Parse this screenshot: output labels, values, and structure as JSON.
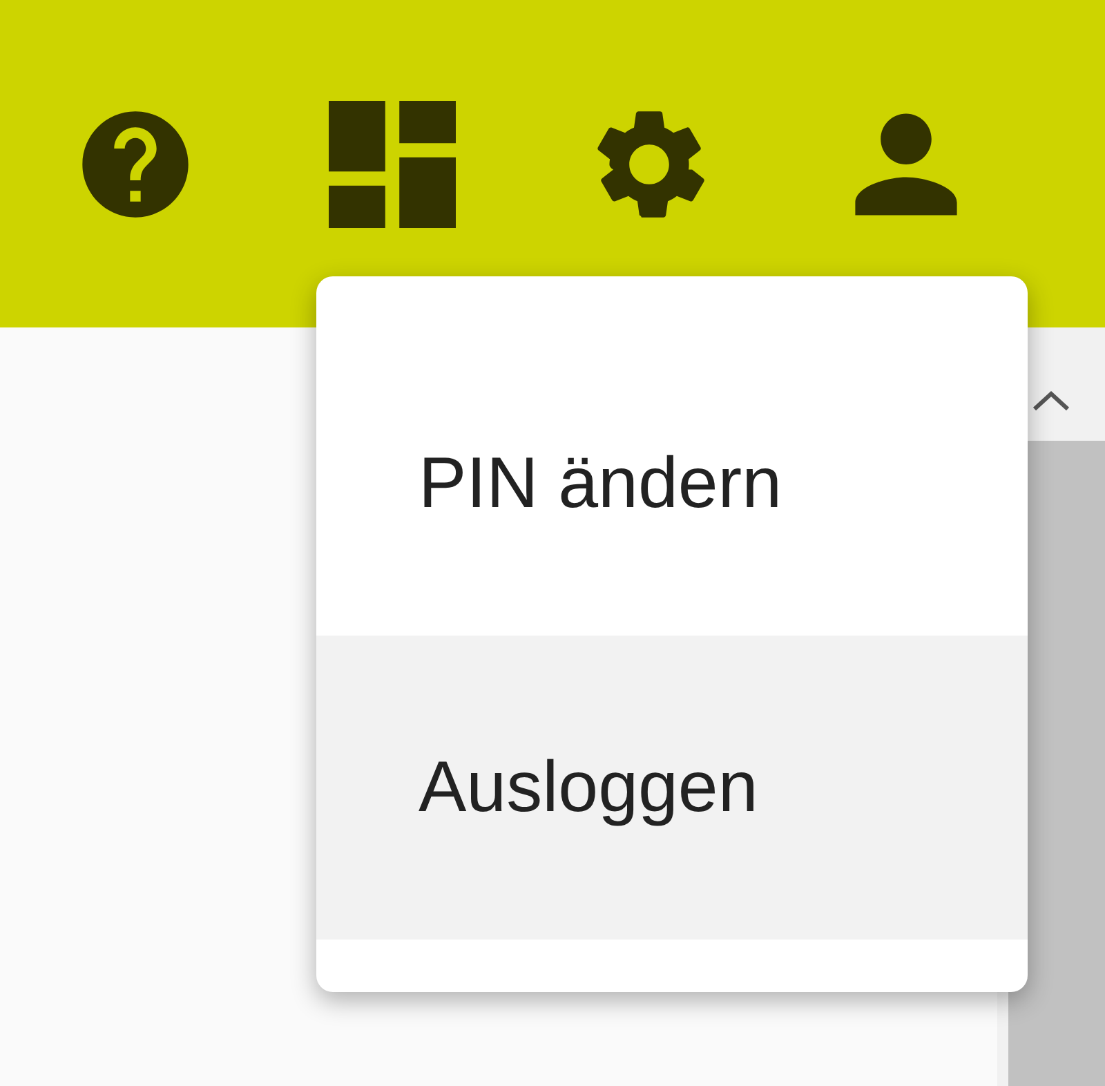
{
  "toolbar": {
    "buttons": [
      {
        "kind": "help"
      },
      {
        "kind": "dashboard"
      },
      {
        "kind": "settings"
      },
      {
        "kind": "account"
      }
    ]
  },
  "menu": {
    "items": [
      {
        "label": "PIN ändern",
        "selected": false
      },
      {
        "label": "Ausloggen",
        "selected": true
      }
    ]
  }
}
